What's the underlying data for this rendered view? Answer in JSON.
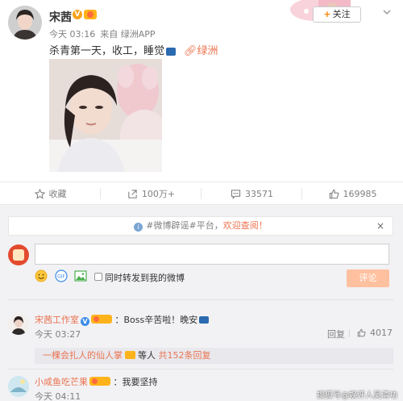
{
  "post": {
    "username": "宋茜",
    "verified_badge": "V",
    "time": "今天 03:16",
    "source": "来自 绿洲APP",
    "follow_label": "关注",
    "follow_plus": "+",
    "text": "杀青第一天，收工，睡觉",
    "link_text": "绿洲",
    "icons": [
      "avatar",
      "verified-badge-icon",
      "vip-level-icon",
      "car-emoji-icon",
      "link-icon",
      "chevron-down-icon"
    ]
  },
  "actions": [
    {
      "label": "收藏",
      "icon": "star-icon"
    },
    {
      "label": "100万+",
      "icon": "repost-icon"
    },
    {
      "label": "33571",
      "icon": "comment-icon"
    },
    {
      "label": "169985",
      "icon": "thumb-up-icon"
    }
  ],
  "notice": {
    "text": "#微博辟谣#平台，",
    "link": "欢迎查阅！",
    "close": "×"
  },
  "composer": {
    "repost_label": "同时转发到我的微博",
    "submit_label": "评论",
    "input_value": ""
  },
  "comments": [
    {
      "user": "宋茜工作室",
      "text": "：Boss辛苦啦！晚安",
      "time": "今天 03:27",
      "reply_label": "回复",
      "likes": "4017",
      "sub_reply": {
        "user": "一棵会扎人的仙人掌",
        "text": "等人",
        "count": "共152条回复"
      }
    },
    {
      "user": "小咸鱼吃芒果",
      "text": "：我要坚持",
      "time": "今天 04:11"
    }
  ],
  "watermark": "搜狐号@娱评人吴清功",
  "colors": {
    "accent": "#eb7350",
    "submit": "#ffc09f",
    "panel_bg": "#f2f2f5",
    "vip": "#f7a21b"
  }
}
